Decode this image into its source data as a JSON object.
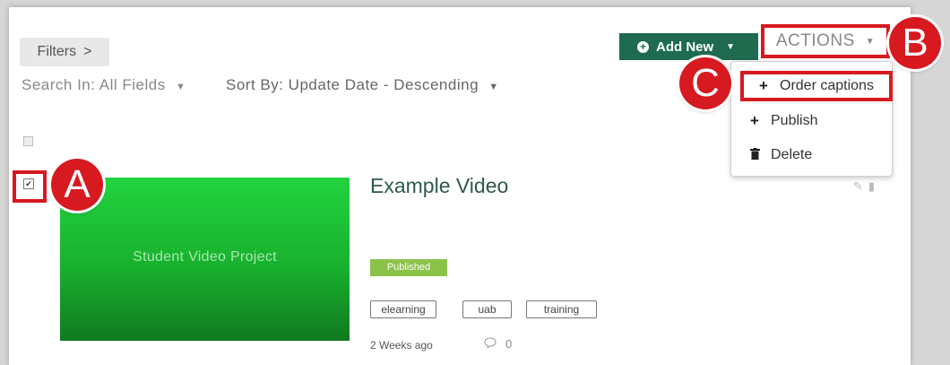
{
  "toolbar": {
    "filters_label": "Filters",
    "filters_chevron": ">",
    "search_in_label": "Search In: All Fields",
    "sort_by_label": "Sort By: Update Date - Descending",
    "chevron_down": "⌄",
    "add_new_label": "Add New",
    "actions_label": "ACTIONS"
  },
  "actions_menu": {
    "items": [
      {
        "label": "Order captions",
        "icon": "plus-icon"
      },
      {
        "label": "Publish",
        "icon": "plus-icon"
      },
      {
        "label": "Delete",
        "icon": "trash-icon"
      }
    ]
  },
  "callouts": {
    "a": "A",
    "b": "B",
    "c": "C",
    "color": "#d71920"
  },
  "entry": {
    "thumbnail_text": "Student Video Project",
    "title": "Example Video",
    "status": "Published",
    "tags": [
      "elearning",
      "uab",
      "training"
    ],
    "posted": "2 Weeks ago",
    "comment_count": "0"
  },
  "colors": {
    "accent": "#1f6b4f",
    "published": "#8bc34a",
    "thumbnail": "#22d43e"
  }
}
